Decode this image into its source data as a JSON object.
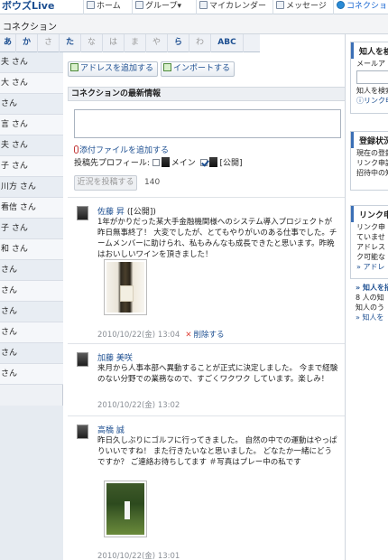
{
  "app": {
    "brand": "ボウズLive",
    "nav": [
      {
        "label": "ホーム",
        "active": false
      },
      {
        "label": "グループ▾",
        "active": false
      },
      {
        "label": "マイカレンダー",
        "active": false
      },
      {
        "label": "メッセージ",
        "active": false
      },
      {
        "label": "コネクション",
        "active": true
      }
    ]
  },
  "page": {
    "title": "コネクション"
  },
  "kana_tabs": [
    {
      "label": "あ",
      "on": true
    },
    {
      "label": "か",
      "on": true
    },
    {
      "label": "さ",
      "on": false
    },
    {
      "label": "た",
      "on": true
    },
    {
      "label": "な",
      "on": false
    },
    {
      "label": "は",
      "on": false
    },
    {
      "label": "ま",
      "on": false
    },
    {
      "label": "や",
      "on": false
    },
    {
      "label": "ら",
      "on": true
    },
    {
      "label": "わ",
      "on": false
    },
    {
      "label": "ABC",
      "on": true
    }
  ],
  "contacts": [
    "夫 さん",
    "大 さん",
    "さん",
    "言 さん",
    "夫 さん",
    "子 さん",
    "川方 さん",
    "看信 さん",
    "子 さん",
    "和 さん",
    "さん",
    "さん",
    "さん",
    "さん",
    "さん",
    "さん"
  ],
  "toolbar": {
    "add_address": "アドレスを追加する",
    "import": "インポートする"
  },
  "composer": {
    "section_title": "コネクションの最新情報",
    "attach_label": "添付ファイルを追加する",
    "dest_label": "投稿先プロフィール:",
    "dest_main": "メイン",
    "dest_public": "[公開]",
    "post_button": "近況を投稿する",
    "char_count": "140"
  },
  "posts": [
    {
      "author": "佐藤 昇",
      "visibility": "([公開])",
      "body": "1年がかりだった某大手金融機関様へのシステム導入プロジェクトが昨日無事終了！ 大変でしたが、とてもやりがいのある仕事でした。チームメンバーに助けられ、私もみんなも成長できたと思います。昨晩はおいしいワインを頂きました！",
      "timestamp": "2010/10/22(金) 13:04",
      "delete_label": "削除する",
      "photo": "wine"
    },
    {
      "author": "加藤 美咲",
      "visibility": "",
      "body": "来月から人事本部へ異動することが正式に決定しました。 今まで経験のない分野での業務なので、すごくワクワク しています。楽しみ！",
      "timestamp": "2010/10/22(金) 13:02",
      "delete_label": "",
      "photo": ""
    },
    {
      "author": "高橋 誠",
      "visibility": "",
      "body": "昨日久しぶりにゴルフに行ってきました。 自然の中での運動はやっぱりいいですね！ また行きたいなと思いました。 どなたか一緒にどうですか？ ご連絡お待ちしてます ＃写真はプレー中の私です",
      "timestamp": "2010/10/22(金) 13:01",
      "delete_label": "",
      "photo": "golf"
    }
  ],
  "right": {
    "box1": {
      "title": "知人を検",
      "l1": "メールア",
      "l2": "知人を検索",
      "l3": "ⓘリンク申"
    },
    "box2": {
      "title": "登録状況",
      "l1": "現在の登録",
      "l2": "リンク申請",
      "l3": "招待中の知"
    },
    "box3": {
      "title": "リンク申",
      "l1": "リンク申",
      "l2": "ていませ",
      "l3": "アドレス",
      "l4": "ク可能な",
      "link": "» アドレ"
    },
    "box4": {
      "title": "» 知人を招",
      "l1": "8 人の知",
      "l2": "知人のう",
      "link": "» 知人を"
    }
  }
}
